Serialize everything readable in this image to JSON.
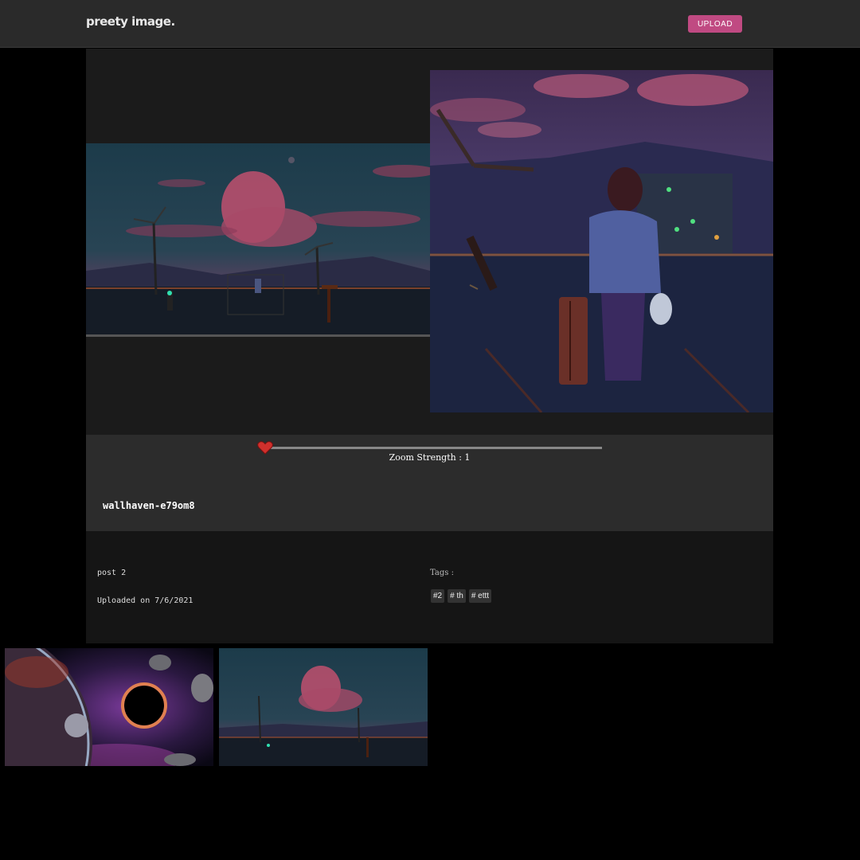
{
  "navbar": {
    "logo": "preety image.",
    "upload_label": "UPLOAD"
  },
  "viewer": {
    "zoom_label": "Zoom Strength : 1",
    "zoom_value": 1,
    "image_name": "wallhaven-e79om8"
  },
  "post": {
    "title": "post 2",
    "uploaded": "Uploaded on 7/6/2021",
    "tags_label": "Tags :",
    "tags": [
      "#2",
      "# th",
      "# ettt"
    ]
  },
  "colors": {
    "accent": "#c04a82",
    "navbar": "#2a2a2a",
    "panel": "#1b1b1b",
    "zoom_panel": "#2c2c2c",
    "slider_thumb": "#d0302c"
  },
  "gallery": [
    {
      "icon": "space-black-hole-image"
    },
    {
      "icon": "anime-windmill-sunset-image"
    }
  ]
}
